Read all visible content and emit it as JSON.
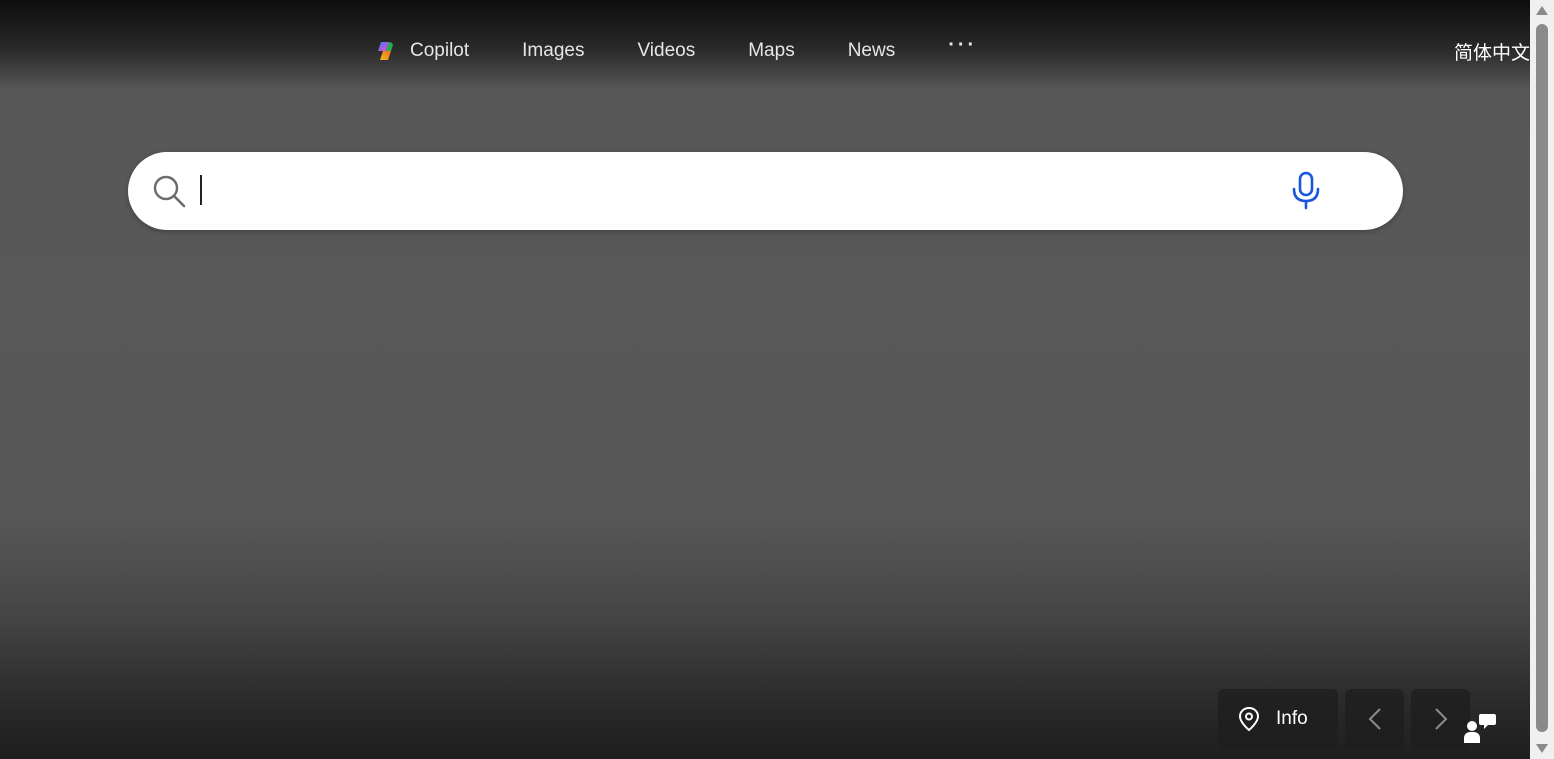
{
  "nav": {
    "items": [
      {
        "label": "Copilot",
        "icon": "copilot-icon"
      },
      {
        "label": "Images"
      },
      {
        "label": "Videos"
      },
      {
        "label": "Maps"
      },
      {
        "label": "News"
      }
    ],
    "more_label": "···"
  },
  "language_link": "简体中文",
  "search": {
    "value": "",
    "placeholder": "",
    "icon": "search-icon",
    "voice_icon": "microphone-icon"
  },
  "image_controls": {
    "info_label": "Info",
    "info_icon": "location-pin-icon",
    "prev_icon": "chevron-left-icon",
    "next_icon": "chevron-right-icon",
    "feedback_icon": "feedback-icon"
  },
  "colors": {
    "background": "#575757",
    "search_bg": "#ffffff",
    "mic_accent": "#1a56db",
    "nav_text": "#e6e6e6"
  }
}
